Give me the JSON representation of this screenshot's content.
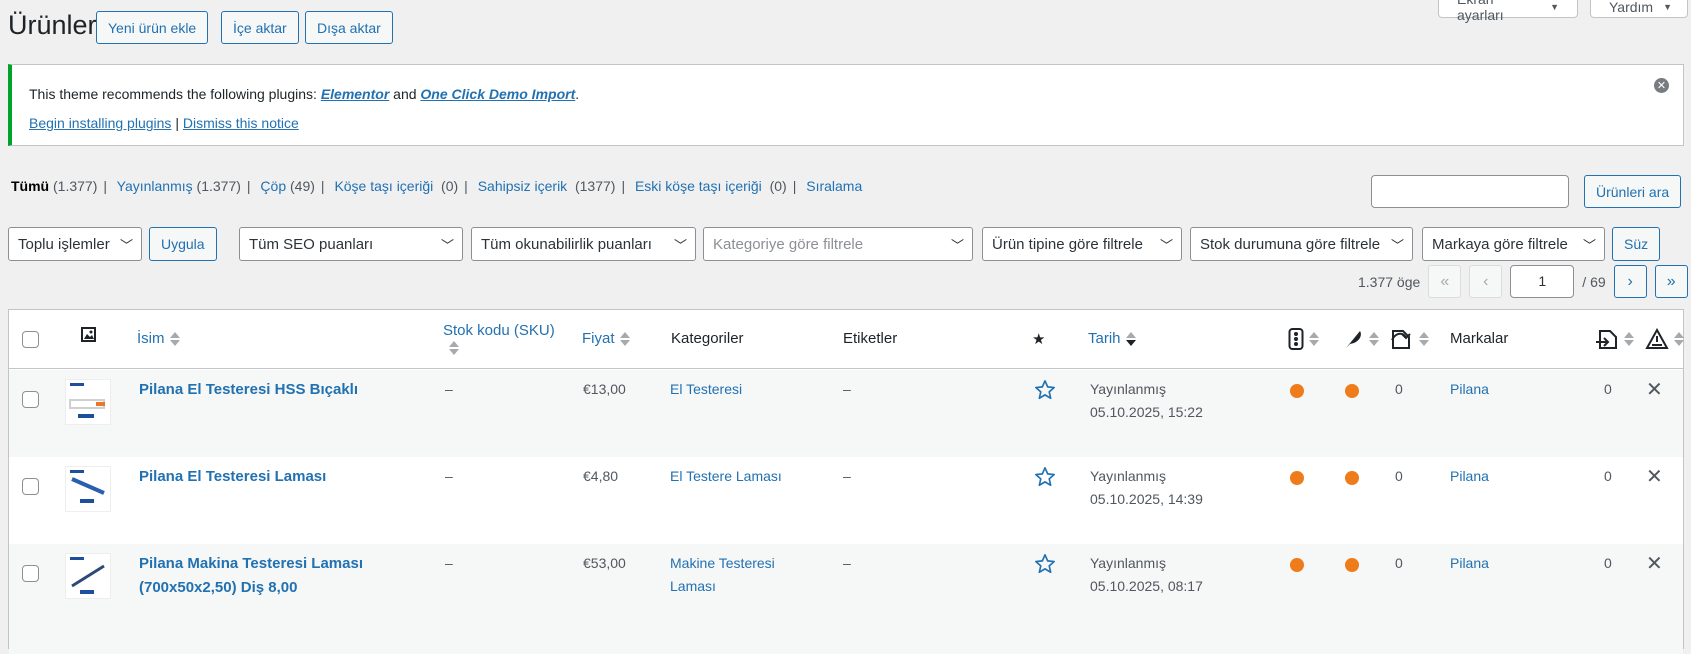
{
  "header": {
    "title": "Ürünler",
    "add_new": "Yeni ürün ekle",
    "import": "İçe aktar",
    "export": "Dışa aktar",
    "screen_options": "Ekran ayarları",
    "help": "Yardım"
  },
  "notice": {
    "text_prefix": "This theme recommends the following plugins: ",
    "plugin1": "Elementor",
    "and": " and ",
    "plugin2": "One Click Demo Import",
    "period": ".",
    "begin_installing": "Begin installing plugins",
    "separator": " | ",
    "dismiss": "Dismiss this notice",
    "accent_color": "#00a32a"
  },
  "views": [
    {
      "label": "Tümü",
      "count": "(1.377)"
    },
    {
      "label": "Yayınlanmış",
      "count": "(1.377)"
    },
    {
      "label": "Çöp",
      "count": "(49)"
    },
    {
      "label": "Köşe taşı içeriği",
      "count": "(0)"
    },
    {
      "label": "Sahipsiz içerik",
      "count": "(1377)"
    },
    {
      "label": "Eski köşe taşı içeriği",
      "count": "(0)"
    },
    {
      "label": "Sıralama",
      "count": ""
    }
  ],
  "search": {
    "value": "",
    "button": "Ürünleri ara"
  },
  "filters": {
    "bulk_actions": "Toplu işlemler",
    "apply": "Uygula",
    "seo": "Tüm SEO puanları",
    "readability": "Tüm okunabilirlik puanları",
    "category_placeholder": "Kategoriye göre filtrele",
    "product_type": "Ürün tipine göre filtrele",
    "stock": "Stok durumuna göre filtrele",
    "brand": "Markaya göre filtrele",
    "filter": "Süz"
  },
  "pagination": {
    "items": "1.377 öge",
    "first": "«",
    "prev": "‹",
    "current": "1",
    "total": "/ 69",
    "next": "›",
    "last": "»"
  },
  "columns": {
    "name": "İsim",
    "sku": "Stok kodu (SKU)",
    "price": "Fiyat",
    "categories": "Kategoriler",
    "tags": "Etiketler",
    "date": "Tarih",
    "brands": "Markalar"
  },
  "status_color": "#ee7c1b",
  "rows": [
    {
      "name": "Pilana El Testeresi HSS Bıçaklı",
      "name2": "",
      "sku": "–",
      "price": "€13,00",
      "category": "El Testeresi",
      "category2": "",
      "tags": "–",
      "status": "Yayınlanmış",
      "date": "05.10.2025, 15:22",
      "links": "0",
      "brand": "Pilana",
      "incoming": "0"
    },
    {
      "name": "Pilana El Testeresi Laması",
      "name2": "",
      "sku": "–",
      "price": "€4,80",
      "category": "El Testere Laması",
      "category2": "",
      "tags": "–",
      "status": "Yayınlanmış",
      "date": "05.10.2025, 14:39",
      "links": "0",
      "brand": "Pilana",
      "incoming": "0"
    },
    {
      "name": "Pilana Makina Testeresi Laması",
      "name2": "(700x50x2,50) Diş 8,00",
      "sku": "–",
      "price": "€53,00",
      "category": "Makine Testeresi",
      "category2": "Laması",
      "tags": "–",
      "status": "Yayınlanmış",
      "date": "05.10.2025, 08:17",
      "links": "0",
      "brand": "Pilana",
      "incoming": "0"
    }
  ]
}
